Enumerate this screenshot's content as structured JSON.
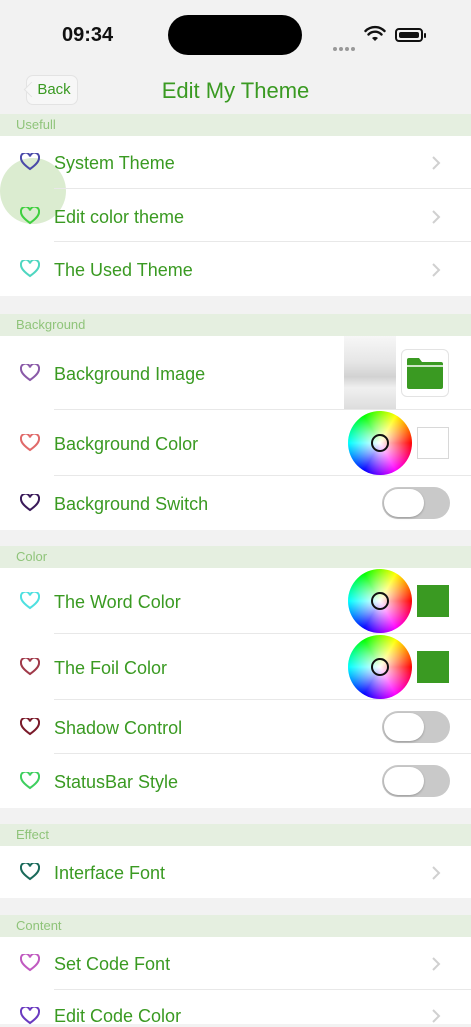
{
  "status_bar": {
    "time": "09:34"
  },
  "nav": {
    "back_label": "Back",
    "title": "Edit My Theme"
  },
  "colors": {
    "accent": "#3a9a22",
    "swatch_word": "#3a9a22",
    "swatch_foil": "#3a9a22"
  },
  "sections": [
    {
      "header": "Usefull",
      "items": [
        {
          "label": "System Theme",
          "heart_color": "#4a4aa8",
          "control": "chevron"
        },
        {
          "label": "Edit color theme",
          "heart_color": "#3fcf3f",
          "control": "chevron"
        },
        {
          "label": "The Used Theme",
          "heart_color": "#4fd6c0",
          "control": "chevron"
        }
      ]
    },
    {
      "header": "Background",
      "items": [
        {
          "label": "Background Image",
          "heart_color": "#8a5aa8",
          "control": "image-folder"
        },
        {
          "label": "Background Color",
          "heart_color": "#e06a6a",
          "control": "color-wheel-empty"
        },
        {
          "label": "Background Switch",
          "heart_color": "#3a1a5a",
          "control": "toggle",
          "on": false
        }
      ]
    },
    {
      "header": "Color",
      "items": [
        {
          "label": "The Word Color",
          "heart_color": "#4fe0e0",
          "control": "color-wheel-swatch"
        },
        {
          "label": "The Foil Color",
          "heart_color": "#a03a4a",
          "control": "color-wheel-swatch"
        },
        {
          "label": "Shadow Control",
          "heart_color": "#7a1a2a",
          "control": "toggle",
          "on": false
        },
        {
          "label": "StatusBar Style",
          "heart_color": "#3fcf5f",
          "control": "toggle",
          "on": false
        }
      ]
    },
    {
      "header": "Effect",
      "items": [
        {
          "label": "Interface Font",
          "heart_color": "#1a6a5a",
          "control": "chevron"
        }
      ]
    },
    {
      "header": "Content",
      "items": [
        {
          "label": "Set Code Font",
          "heart_color": "#c05ac0",
          "control": "chevron"
        },
        {
          "label": "Edit Code Color",
          "heart_color": "#6a3ac0",
          "control": "chevron"
        }
      ]
    }
  ]
}
